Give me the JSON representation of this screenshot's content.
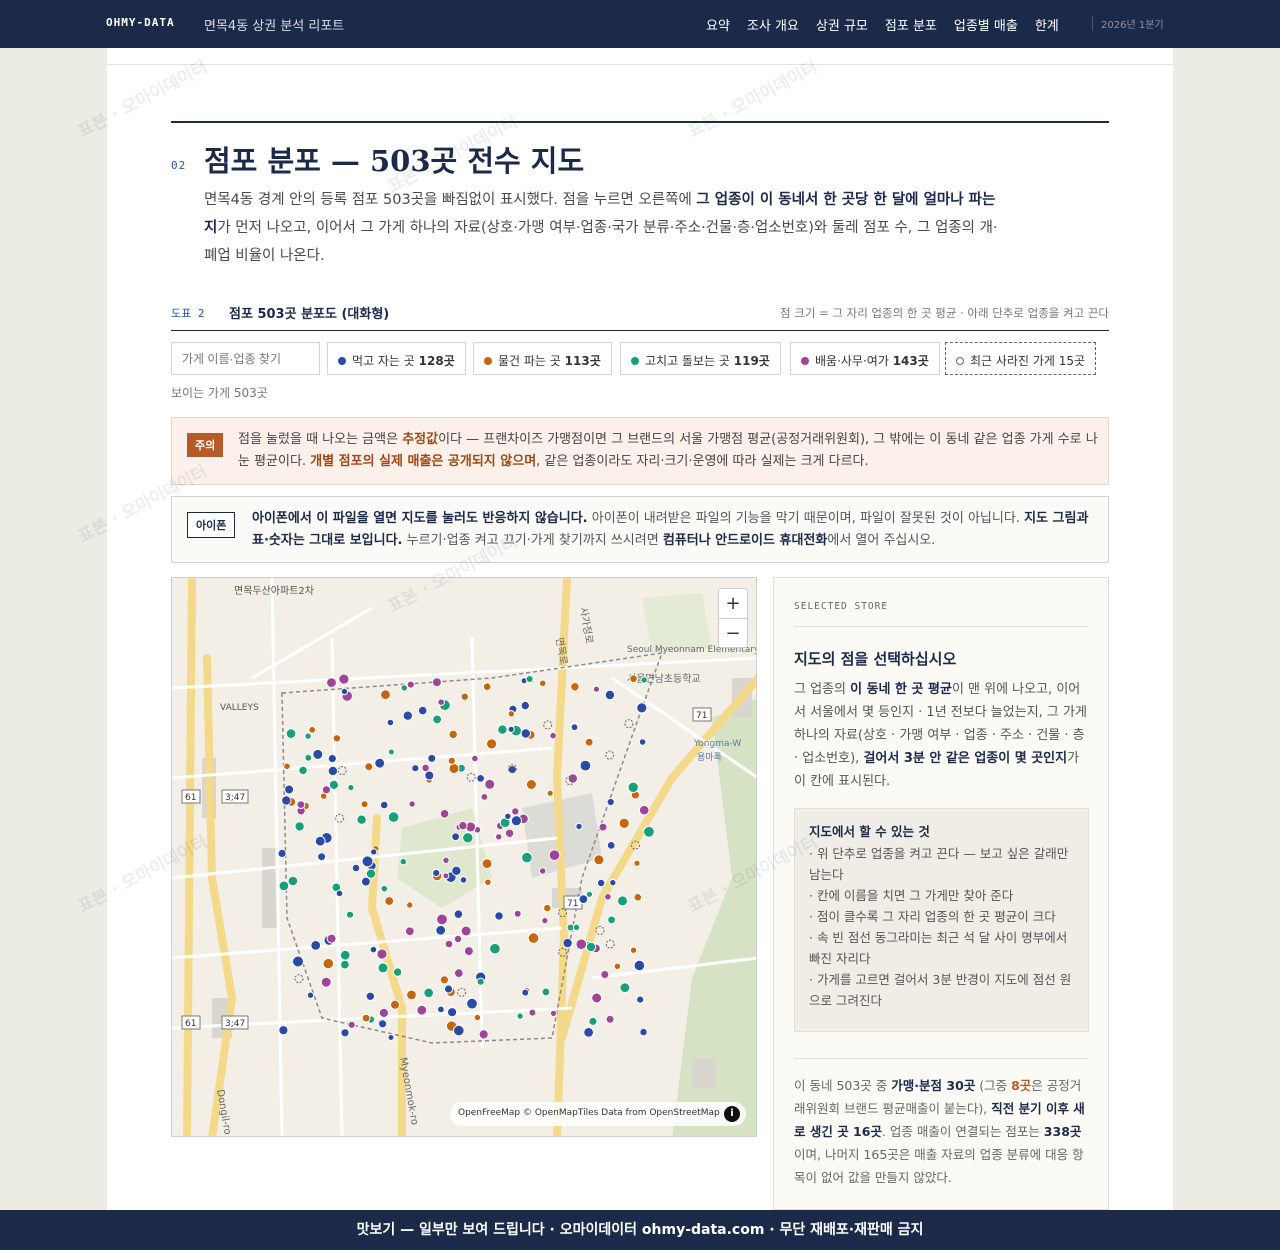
{
  "header": {
    "brand": "OHMY-DATA",
    "subtitle": "면목4동 상권 분석 리포트",
    "nav": [
      "요약",
      "조사 개요",
      "상권 규모",
      "점포 분포",
      "업종별 매출",
      "한계"
    ],
    "period": "2026년 1분기"
  },
  "section": {
    "number": "02",
    "title": "점포 분포 — 503곳 전수 지도",
    "intro_1": "면목4동 경계 안의 등록 점포 503곳을 빠짐없이 표시했다. 점을 누르면 오른쪽에 ",
    "intro_b": "그 업종이 이 동네서 한 곳당 한 달에 얼마나 파는지",
    "intro_2": "가 먼저 나오고, 이어서 그 가게 하나의 자료(상호·가맹 여부·업종·국가 분류·주소·건물·층·업소번호)와 둘레 점포 수, 그 업종의 개·폐업 비율이 나온다."
  },
  "figure": {
    "label": "도표 2",
    "title": "점포 503곳 분포도 (대화형)",
    "note": "점 크기 = 그 자리 업종의 한 곳 평균 · 아래 단추로 업종을 켜고 끈다"
  },
  "filters": {
    "search_placeholder": "가게 이름·업종 찾기",
    "chips": [
      {
        "label": "먹고 자는 곳",
        "count": "128곳",
        "color": "#2a4aa8"
      },
      {
        "label": "물건 파는 곳",
        "count": "113곳",
        "color": "#c8640a"
      },
      {
        "label": "고치고 돌보는 곳",
        "count": "119곳",
        "color": "#16a07a"
      },
      {
        "label": "배움·사무·여가",
        "count": "143곳",
        "color": "#a0449a"
      },
      {
        "label": "최근 사라진 가게",
        "count": "15곳",
        "color": "#666666"
      }
    ],
    "visible": "보이는 가게 503곳"
  },
  "caution": {
    "tag": "주의",
    "t1": "점을 눌렀을 때 나오는 금액은 ",
    "b1": "추정값",
    "t2": "이다 — 프랜차이즈 가맹점이면 그 브랜드의 서울 가맹점 평균(공정거래위원회), 그 밖에는 이 동네 같은 업종 가게 수로 나눈 평균이다. ",
    "b2": "개별 점포의 실제 매출은 공개되지 않으며",
    "t3": ", 같은 업종이라도 자리·크기·운영에 따라 실제는 크게 다르다."
  },
  "iphone": {
    "tag": "아이폰",
    "b1": "아이폰에서 이 파일을 열면 지도를 눌러도 반응하지 않습니다.",
    "t1": " 아이폰이 내려받은 파일의 기능을 막기 때문이며, 파일이 잘못된 것이 아닙니다. ",
    "b2": "지도 그림과 표·숫자는 그대로 보입니다.",
    "t2": " 누르기·업종 켜고 끄기·가게 찾기까지 쓰시려면 ",
    "b3": "컴퓨터나 안드로이드 휴대전화",
    "t3": "에서 열어 주십시오."
  },
  "map": {
    "labels": {
      "apt": "면목두산아파트2차",
      "valleys": "VALLEYS",
      "school_en": "Seoul Myeonnam Elementary School",
      "school_ko": "서울면남초등학교",
      "station": "Yongma-W",
      "station_ko": "용마폭",
      "road_a": "면목로",
      "road_b": "사가정로",
      "road_c": "Myeonmok-ro",
      "road_d": "Dongil-ro",
      "shield_61": "61",
      "shield_71": "71",
      "shield_347": "3;47"
    },
    "zoom_in": "+",
    "zoom_out": "−",
    "attribution": "OpenFreeMap © OpenMapTiles Data from OpenStreetMap",
    "info": "i"
  },
  "panel": {
    "eyebrow": "SELECTED STORE",
    "heading": "지도의 점을 선택하십시오",
    "p1_a": "그 업종의 ",
    "p1_b1": "이 동네 한 곳 평균",
    "p1_c": "이 맨 위에 나오고, 이어서 서울에서 몇 등인지 · 1년 전보다 늘었는지, 그 가게 하나의 자료(상호 · 가맹 여부 · 업종 · 주소 · 건물 · 층 · 업소번호), ",
    "p1_b2": "걸어서 3분 안 같은 업종이 몇 곳인지",
    "p1_d": "가 이 칸에 표시된다.",
    "box_title": "지도에서 할 수 있는 것",
    "box_items": [
      "· 위 단추로 업종을 켜고 끈다 — 보고 싶은 갈래만 남는다",
      "· 칸에 이름을 치면 그 가게만 찾아 준다",
      "· 점이 클수록 그 자리 업종의 한 곳 평균이 크다",
      "· 속 빈 점선 동그라미는 최근 석 달 사이 명부에서 빠진 자리다",
      "· 가게를 고르면 걸어서 3분 반경이 지도에 점선 원으로 그려진다"
    ],
    "p2_a": "이 동네 503곳 중 ",
    "p2_b1": "가맹·분점 30곳",
    "p2_c": " (그중 ",
    "p2_o": "8곳",
    "p2_d": "은 공정거래위원회 브랜드 평균매출이 붙는다), ",
    "p2_b2": "직전 분기 이후 새로 생긴 곳 16곳",
    "p2_e": ". 업종 매출이 연결되는 점포는 ",
    "p2_b3": "338곳",
    "p2_f": "이며, 나머지 165곳은 매출 자료의 업종 분류에 대응 항목이 없어 값을 만들지 않았다."
  },
  "footer": "맛보기 — 일부만 보여 드립니다 · 오마이데이터 ohmy-data.com · 무단 재배포·재판매 금지",
  "watermark": [
    "표본 · 오마이데이터",
    "오마이데이터 · ohmy-data.com · 무단 재배포·재판매 금지"
  ]
}
